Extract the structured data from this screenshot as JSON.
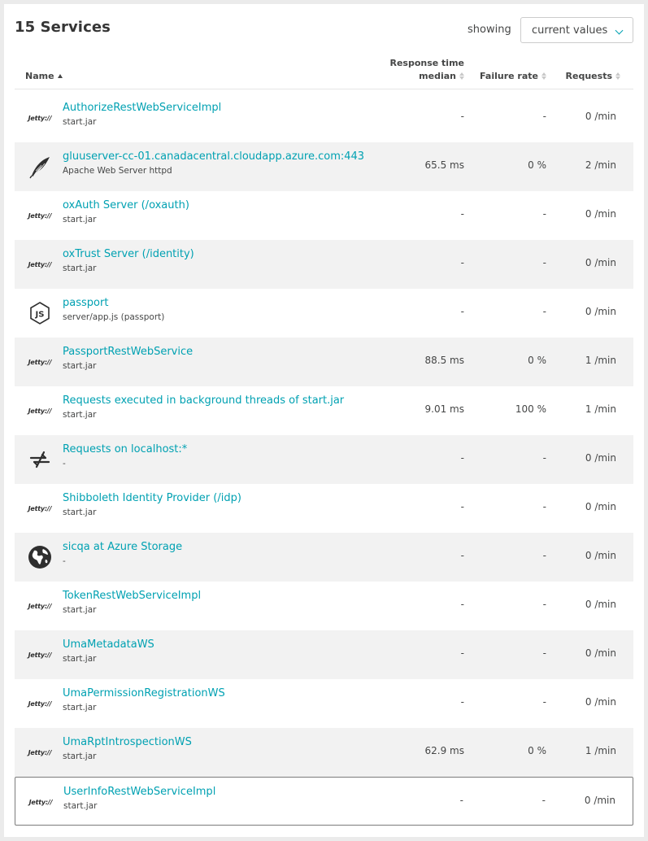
{
  "header": {
    "title": "15 Services",
    "showing_label": "showing",
    "select_value": "current values"
  },
  "columns": {
    "name": "Name",
    "response_line1": "Response time",
    "response_line2": "median",
    "failure": "Failure rate",
    "requests": "Requests"
  },
  "services": [
    {
      "name": "AuthorizeRestWebServiceImpl",
      "sub": "start.jar",
      "icon": "jetty-logo-icon",
      "response": "-",
      "failure": "-",
      "requests": "0 /min"
    },
    {
      "name": "gluuserver-cc-01.canadacentral.cloudapp.azure.com:443",
      "sub": "Apache Web Server httpd",
      "icon": "apache-feather-icon",
      "response": "65.5 ms",
      "failure": "0 %",
      "requests": "2 /min"
    },
    {
      "name": "oxAuth Server (/oxauth)",
      "sub": "start.jar",
      "icon": "jetty-logo-icon",
      "response": "-",
      "failure": "-",
      "requests": "0 /min"
    },
    {
      "name": "oxTrust Server (/identity)",
      "sub": "start.jar",
      "icon": "jetty-logo-icon",
      "response": "-",
      "failure": "-",
      "requests": "0 /min"
    },
    {
      "name": "passport",
      "sub": "server/app.js (passport)",
      "icon": "nodejs-hexagon-icon",
      "response": "-",
      "failure": "-",
      "requests": "0 /min"
    },
    {
      "name": "PassportRestWebService",
      "sub": "start.jar",
      "icon": "jetty-logo-icon",
      "response": "88.5 ms",
      "failure": "0 %",
      "requests": "1 /min"
    },
    {
      "name": "Requests executed in background threads of start.jar",
      "sub": "start.jar",
      "icon": "jetty-logo-icon",
      "response": "9.01 ms",
      "failure": "100 %",
      "requests": "1 /min"
    },
    {
      "name": "Requests on localhost:*",
      "sub": "-",
      "icon": "network-arrows-icon",
      "response": "-",
      "failure": "-",
      "requests": "0 /min"
    },
    {
      "name": "Shibboleth Identity Provider (/idp)",
      "sub": "start.jar",
      "icon": "jetty-logo-icon",
      "response": "-",
      "failure": "-",
      "requests": "0 /min"
    },
    {
      "name": "sicqa at Azure Storage",
      "sub": "-",
      "icon": "globe-icon",
      "response": "-",
      "failure": "-",
      "requests": "0 /min"
    },
    {
      "name": "TokenRestWebServiceImpl",
      "sub": "start.jar",
      "icon": "jetty-logo-icon",
      "response": "-",
      "failure": "-",
      "requests": "0 /min"
    },
    {
      "name": "UmaMetadataWS",
      "sub": "start.jar",
      "icon": "jetty-logo-icon",
      "response": "-",
      "failure": "-",
      "requests": "0 /min"
    },
    {
      "name": "UmaPermissionRegistrationWS",
      "sub": "start.jar",
      "icon": "jetty-logo-icon",
      "response": "-",
      "failure": "-",
      "requests": "0 /min"
    },
    {
      "name": "UmaRptIntrospectionWS",
      "sub": "start.jar",
      "icon": "jetty-logo-icon",
      "response": "62.9 ms",
      "failure": "0 %",
      "requests": "1 /min"
    },
    {
      "name": "UserInfoRestWebServiceImpl",
      "sub": "start.jar",
      "icon": "jetty-logo-icon",
      "response": "-",
      "failure": "-",
      "requests": "0 /min"
    }
  ],
  "icon_labels": {
    "jetty": "Jetty://"
  },
  "colors": {
    "link": "#00a1b2",
    "row_alt": "#f2f2f2",
    "text": "#454646"
  }
}
